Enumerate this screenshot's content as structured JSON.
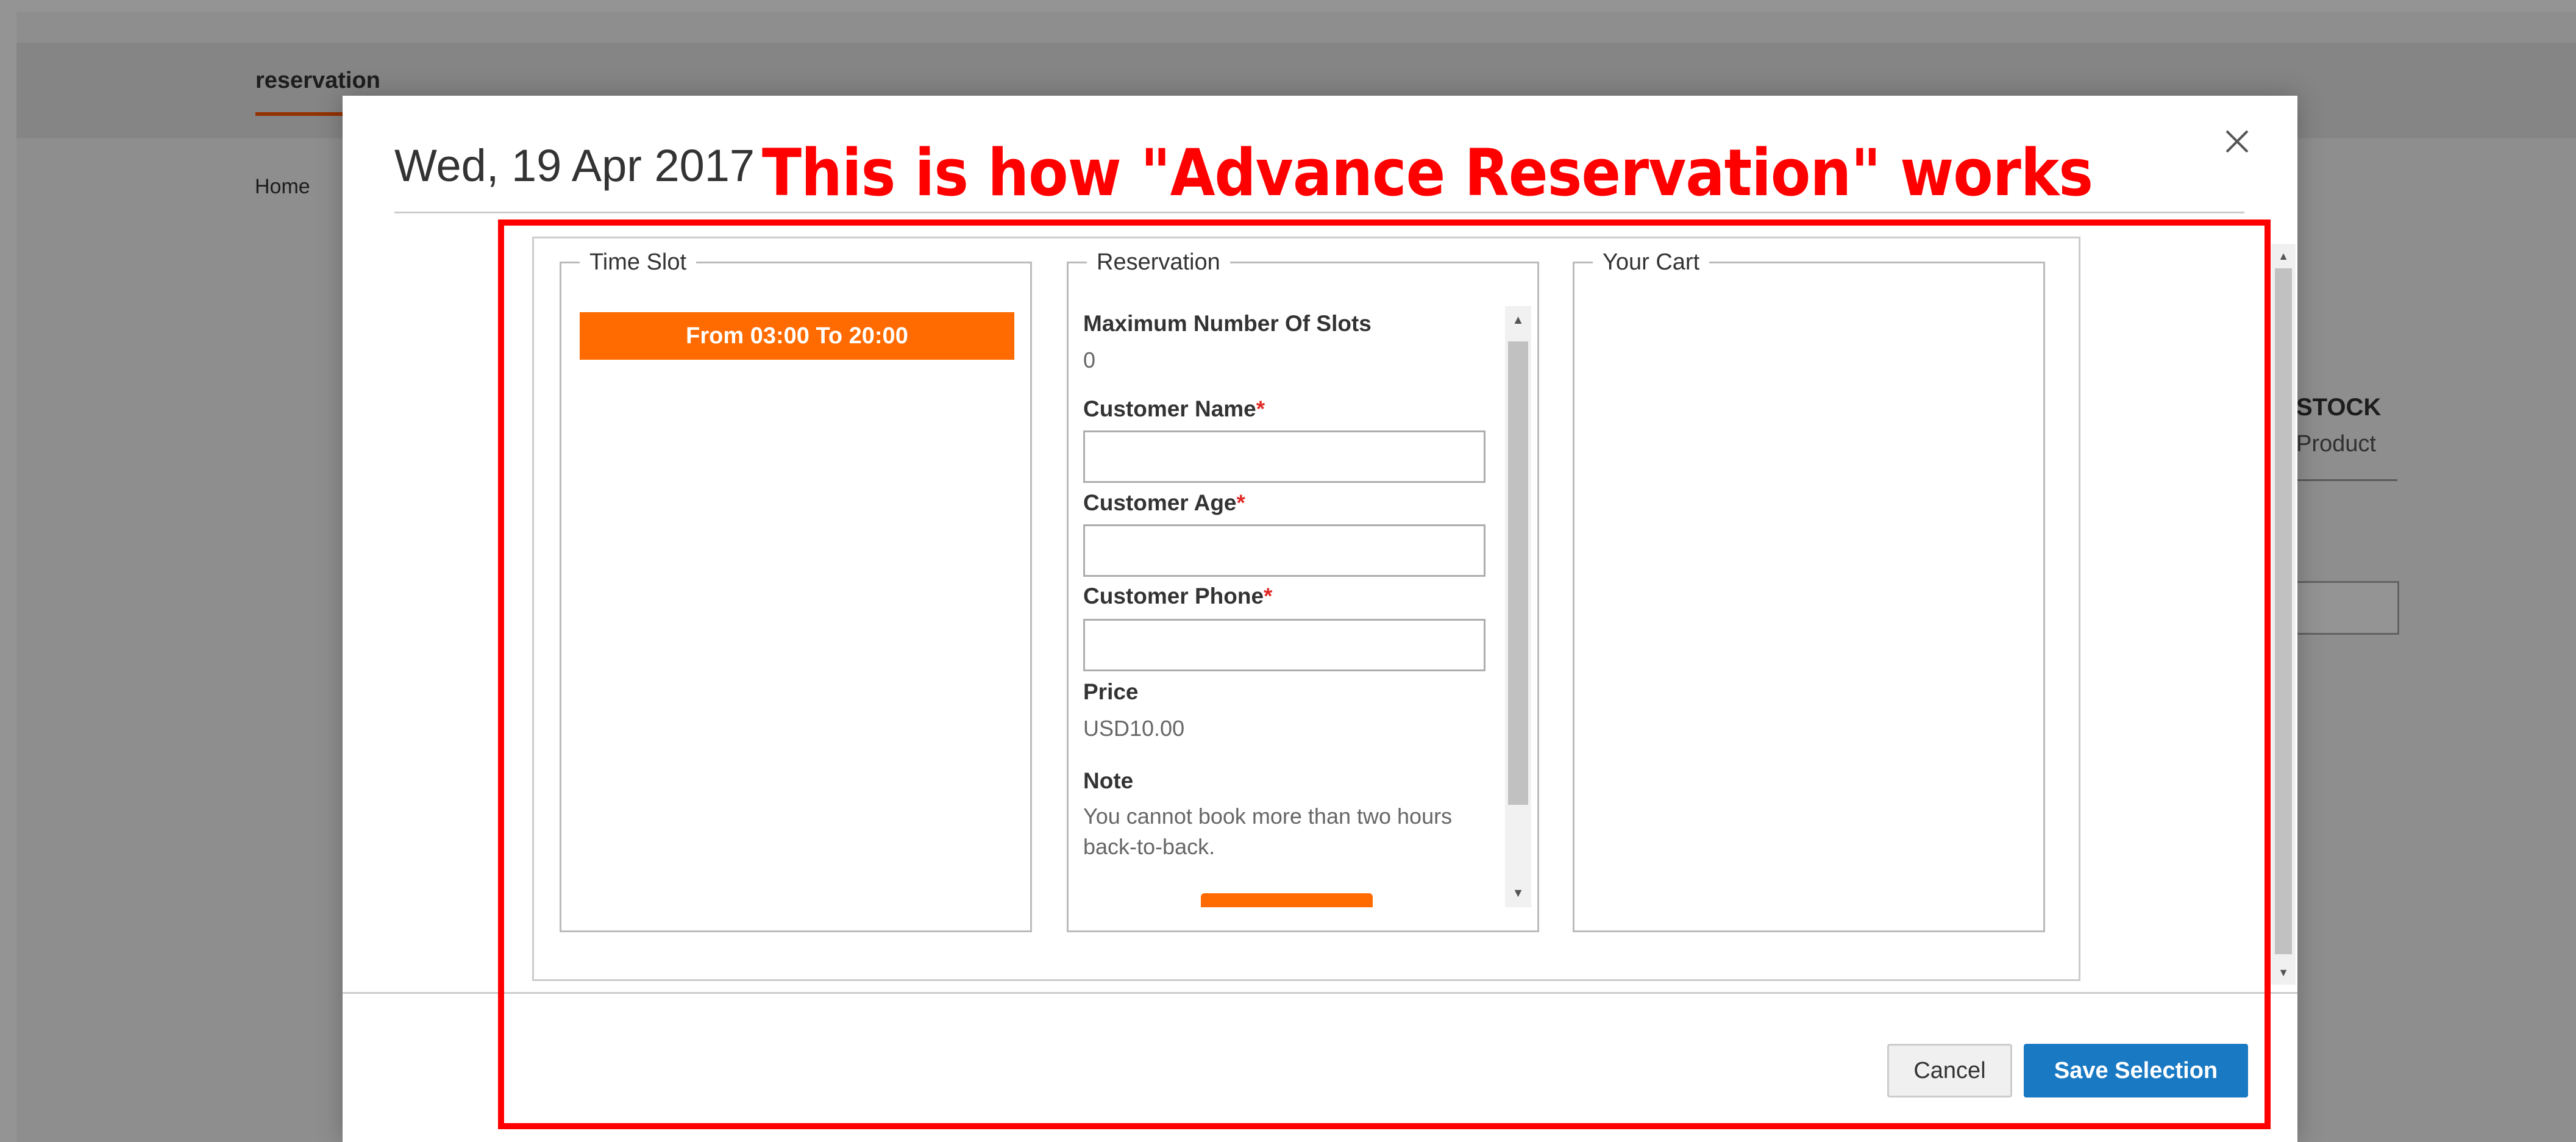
{
  "background": {
    "tab_label": "reservation",
    "breadcrumb": "Home",
    "stock_text": "STOCK",
    "product_text": "Product"
  },
  "modal": {
    "title": "Wed, 19 Apr 2017",
    "time_slot": {
      "legend": "Time Slot",
      "slots": [
        "From 03:00 To 20:00"
      ]
    },
    "reservation": {
      "legend": "Reservation",
      "max_slots_label": "Maximum Number Of Slots",
      "max_slots_value": "0",
      "customer_name_label": "Customer Name",
      "customer_name_value": "",
      "customer_age_label": "Customer Age",
      "customer_age_value": "",
      "customer_phone_label": "Customer Phone",
      "customer_phone_value": "",
      "required_marker": "*",
      "price_label": "Price",
      "price_value": "USD10.00",
      "note_label": "Note",
      "note_text": "You cannot book more than two hours back-to-back."
    },
    "cart": {
      "legend": "Your Cart"
    },
    "buttons": {
      "cancel": "Cancel",
      "save": "Save Selection"
    }
  },
  "annotation": {
    "caption": "This is how \"Advance Reservation\" works",
    "color": "#ff0000"
  },
  "colors": {
    "accent_orange": "#ff6b00",
    "primary_blue": "#1979c3",
    "required_red": "#e02b27"
  }
}
